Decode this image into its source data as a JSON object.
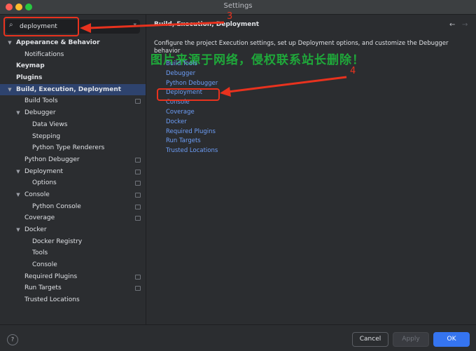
{
  "window": {
    "title": "Settings"
  },
  "search": {
    "value": "deployment",
    "icon": "search-icon"
  },
  "sidebar": {
    "items": [
      {
        "label": "Appearance & Behavior",
        "level": 0,
        "chevron": "down",
        "bold": true
      },
      {
        "label": "Notifications",
        "level": 2
      },
      {
        "label": "Keymap",
        "level": 0,
        "bold": true
      },
      {
        "label": "Plugins",
        "level": 0,
        "bold": true
      },
      {
        "label": "Build, Execution, Deployment",
        "level": 0,
        "chevron": "down",
        "bold": true,
        "selected": true
      },
      {
        "label": "Build Tools",
        "level": 2,
        "project": true
      },
      {
        "label": "Debugger",
        "level": 1,
        "chevron": "down"
      },
      {
        "label": "Data Views",
        "level": 3
      },
      {
        "label": "Stepping",
        "level": 3
      },
      {
        "label": "Python Type Renderers",
        "level": 3
      },
      {
        "label": "Python Debugger",
        "level": 2,
        "project": true
      },
      {
        "label": "Deployment",
        "level": 1,
        "chevron": "down",
        "project": true
      },
      {
        "label": "Options",
        "level": 3,
        "project": true
      },
      {
        "label": "Console",
        "level": 1,
        "chevron": "down",
        "project": true
      },
      {
        "label": "Python Console",
        "level": 3,
        "project": true
      },
      {
        "label": "Coverage",
        "level": 2,
        "project": true
      },
      {
        "label": "Docker",
        "level": 1,
        "chevron": "down"
      },
      {
        "label": "Docker Registry",
        "level": 3
      },
      {
        "label": "Tools",
        "level": 3
      },
      {
        "label": "Console",
        "level": 3
      },
      {
        "label": "Required Plugins",
        "level": 2,
        "project": true
      },
      {
        "label": "Run Targets",
        "level": 2,
        "project": true
      },
      {
        "label": "Trusted Locations",
        "level": 2
      }
    ]
  },
  "main": {
    "breadcrumb": "Build, Execution, Deployment",
    "description": "Configure the project Execution settings, set up Deployment options, and customize the Debugger behavior",
    "watermark": "图片来源于网络，侵权联系站长删除！",
    "links": [
      "Build Tools",
      "Debugger",
      "Python Debugger",
      "Deployment",
      "Console",
      "Coverage",
      "Docker",
      "Required Plugins",
      "Run Targets",
      "Trusted Locations"
    ]
  },
  "footer": {
    "help": "?",
    "cancel": "Cancel",
    "apply": "Apply",
    "ok": "OK"
  },
  "annotations": {
    "step3": "3",
    "step4": "4"
  },
  "colors": {
    "accent": "#3574f0",
    "selection": "#2e436e",
    "link": "#6d9ef8",
    "annotation": "#e8321e",
    "watermark": "#1fa83a"
  }
}
